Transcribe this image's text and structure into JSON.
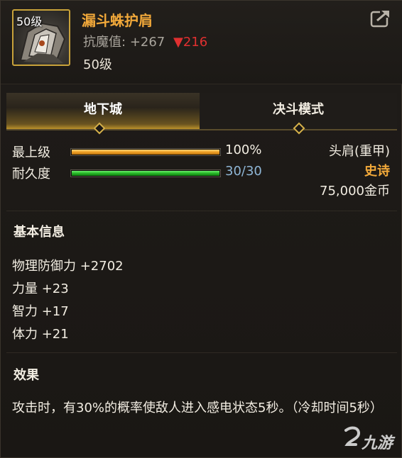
{
  "item": {
    "level_badge": "50级",
    "name": "漏斗蛛护肩",
    "stat_label": "抗魔值:",
    "stat_value": "+267",
    "stat_down_arrow": "▼",
    "stat_down_value": "216",
    "level_text": "50级",
    "icon": "shoulder-armor-icon"
  },
  "header": {
    "share_icon": "share-export-icon"
  },
  "tabs": [
    {
      "label": "地下城",
      "active": true
    },
    {
      "label": "决斗模式",
      "active": false
    }
  ],
  "bars": [
    {
      "label": "最上级",
      "value_text": "100%",
      "fill": 1.0,
      "color": "#f0a024"
    },
    {
      "label": "耐久度",
      "value_text": "30/30",
      "fill": 1.0,
      "color": "#26b626"
    }
  ],
  "info": {
    "type": "头肩(重甲)",
    "rarity": "史诗",
    "rarity_color": "#f2a93a",
    "price": "75,000金币"
  },
  "basic": {
    "title": "基本信息",
    "attrs": [
      "物理防御力 +2702",
      "力量 +23",
      "智力 +17",
      "体力 +21"
    ]
  },
  "effect": {
    "title": "效果",
    "text": "攻击时，有30%的概率使敌人进入感电状态5秒。（冷却时间5秒）"
  },
  "watermark": {
    "text": "九游"
  }
}
